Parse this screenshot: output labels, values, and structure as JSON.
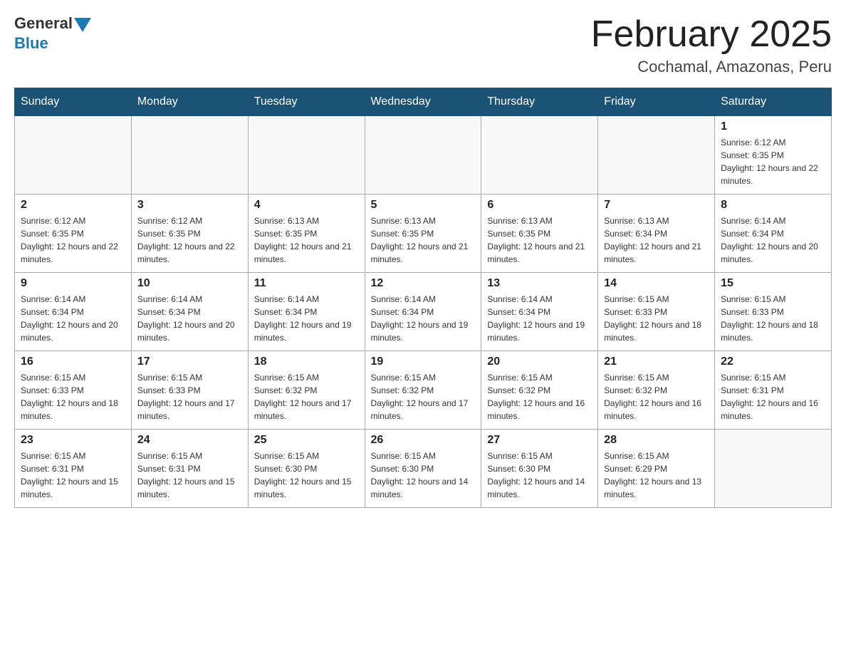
{
  "header": {
    "logo_general": "General",
    "logo_blue": "Blue",
    "month_title": "February 2025",
    "location": "Cochamal, Amazonas, Peru"
  },
  "weekdays": [
    "Sunday",
    "Monday",
    "Tuesday",
    "Wednesday",
    "Thursday",
    "Friday",
    "Saturday"
  ],
  "weeks": [
    [
      {
        "day": "",
        "sunrise": "",
        "sunset": "",
        "daylight": ""
      },
      {
        "day": "",
        "sunrise": "",
        "sunset": "",
        "daylight": ""
      },
      {
        "day": "",
        "sunrise": "",
        "sunset": "",
        "daylight": ""
      },
      {
        "day": "",
        "sunrise": "",
        "sunset": "",
        "daylight": ""
      },
      {
        "day": "",
        "sunrise": "",
        "sunset": "",
        "daylight": ""
      },
      {
        "day": "",
        "sunrise": "",
        "sunset": "",
        "daylight": ""
      },
      {
        "day": "1",
        "sunrise": "Sunrise: 6:12 AM",
        "sunset": "Sunset: 6:35 PM",
        "daylight": "Daylight: 12 hours and 22 minutes."
      }
    ],
    [
      {
        "day": "2",
        "sunrise": "Sunrise: 6:12 AM",
        "sunset": "Sunset: 6:35 PM",
        "daylight": "Daylight: 12 hours and 22 minutes."
      },
      {
        "day": "3",
        "sunrise": "Sunrise: 6:12 AM",
        "sunset": "Sunset: 6:35 PM",
        "daylight": "Daylight: 12 hours and 22 minutes."
      },
      {
        "day": "4",
        "sunrise": "Sunrise: 6:13 AM",
        "sunset": "Sunset: 6:35 PM",
        "daylight": "Daylight: 12 hours and 21 minutes."
      },
      {
        "day": "5",
        "sunrise": "Sunrise: 6:13 AM",
        "sunset": "Sunset: 6:35 PM",
        "daylight": "Daylight: 12 hours and 21 minutes."
      },
      {
        "day": "6",
        "sunrise": "Sunrise: 6:13 AM",
        "sunset": "Sunset: 6:35 PM",
        "daylight": "Daylight: 12 hours and 21 minutes."
      },
      {
        "day": "7",
        "sunrise": "Sunrise: 6:13 AM",
        "sunset": "Sunset: 6:34 PM",
        "daylight": "Daylight: 12 hours and 21 minutes."
      },
      {
        "day": "8",
        "sunrise": "Sunrise: 6:14 AM",
        "sunset": "Sunset: 6:34 PM",
        "daylight": "Daylight: 12 hours and 20 minutes."
      }
    ],
    [
      {
        "day": "9",
        "sunrise": "Sunrise: 6:14 AM",
        "sunset": "Sunset: 6:34 PM",
        "daylight": "Daylight: 12 hours and 20 minutes."
      },
      {
        "day": "10",
        "sunrise": "Sunrise: 6:14 AM",
        "sunset": "Sunset: 6:34 PM",
        "daylight": "Daylight: 12 hours and 20 minutes."
      },
      {
        "day": "11",
        "sunrise": "Sunrise: 6:14 AM",
        "sunset": "Sunset: 6:34 PM",
        "daylight": "Daylight: 12 hours and 19 minutes."
      },
      {
        "day": "12",
        "sunrise": "Sunrise: 6:14 AM",
        "sunset": "Sunset: 6:34 PM",
        "daylight": "Daylight: 12 hours and 19 minutes."
      },
      {
        "day": "13",
        "sunrise": "Sunrise: 6:14 AM",
        "sunset": "Sunset: 6:34 PM",
        "daylight": "Daylight: 12 hours and 19 minutes."
      },
      {
        "day": "14",
        "sunrise": "Sunrise: 6:15 AM",
        "sunset": "Sunset: 6:33 PM",
        "daylight": "Daylight: 12 hours and 18 minutes."
      },
      {
        "day": "15",
        "sunrise": "Sunrise: 6:15 AM",
        "sunset": "Sunset: 6:33 PM",
        "daylight": "Daylight: 12 hours and 18 minutes."
      }
    ],
    [
      {
        "day": "16",
        "sunrise": "Sunrise: 6:15 AM",
        "sunset": "Sunset: 6:33 PM",
        "daylight": "Daylight: 12 hours and 18 minutes."
      },
      {
        "day": "17",
        "sunrise": "Sunrise: 6:15 AM",
        "sunset": "Sunset: 6:33 PM",
        "daylight": "Daylight: 12 hours and 17 minutes."
      },
      {
        "day": "18",
        "sunrise": "Sunrise: 6:15 AM",
        "sunset": "Sunset: 6:32 PM",
        "daylight": "Daylight: 12 hours and 17 minutes."
      },
      {
        "day": "19",
        "sunrise": "Sunrise: 6:15 AM",
        "sunset": "Sunset: 6:32 PM",
        "daylight": "Daylight: 12 hours and 17 minutes."
      },
      {
        "day": "20",
        "sunrise": "Sunrise: 6:15 AM",
        "sunset": "Sunset: 6:32 PM",
        "daylight": "Daylight: 12 hours and 16 minutes."
      },
      {
        "day": "21",
        "sunrise": "Sunrise: 6:15 AM",
        "sunset": "Sunset: 6:32 PM",
        "daylight": "Daylight: 12 hours and 16 minutes."
      },
      {
        "day": "22",
        "sunrise": "Sunrise: 6:15 AM",
        "sunset": "Sunset: 6:31 PM",
        "daylight": "Daylight: 12 hours and 16 minutes."
      }
    ],
    [
      {
        "day": "23",
        "sunrise": "Sunrise: 6:15 AM",
        "sunset": "Sunset: 6:31 PM",
        "daylight": "Daylight: 12 hours and 15 minutes."
      },
      {
        "day": "24",
        "sunrise": "Sunrise: 6:15 AM",
        "sunset": "Sunset: 6:31 PM",
        "daylight": "Daylight: 12 hours and 15 minutes."
      },
      {
        "day": "25",
        "sunrise": "Sunrise: 6:15 AM",
        "sunset": "Sunset: 6:30 PM",
        "daylight": "Daylight: 12 hours and 15 minutes."
      },
      {
        "day": "26",
        "sunrise": "Sunrise: 6:15 AM",
        "sunset": "Sunset: 6:30 PM",
        "daylight": "Daylight: 12 hours and 14 minutes."
      },
      {
        "day": "27",
        "sunrise": "Sunrise: 6:15 AM",
        "sunset": "Sunset: 6:30 PM",
        "daylight": "Daylight: 12 hours and 14 minutes."
      },
      {
        "day": "28",
        "sunrise": "Sunrise: 6:15 AM",
        "sunset": "Sunset: 6:29 PM",
        "daylight": "Daylight: 12 hours and 13 minutes."
      },
      {
        "day": "",
        "sunrise": "",
        "sunset": "",
        "daylight": ""
      }
    ]
  ]
}
